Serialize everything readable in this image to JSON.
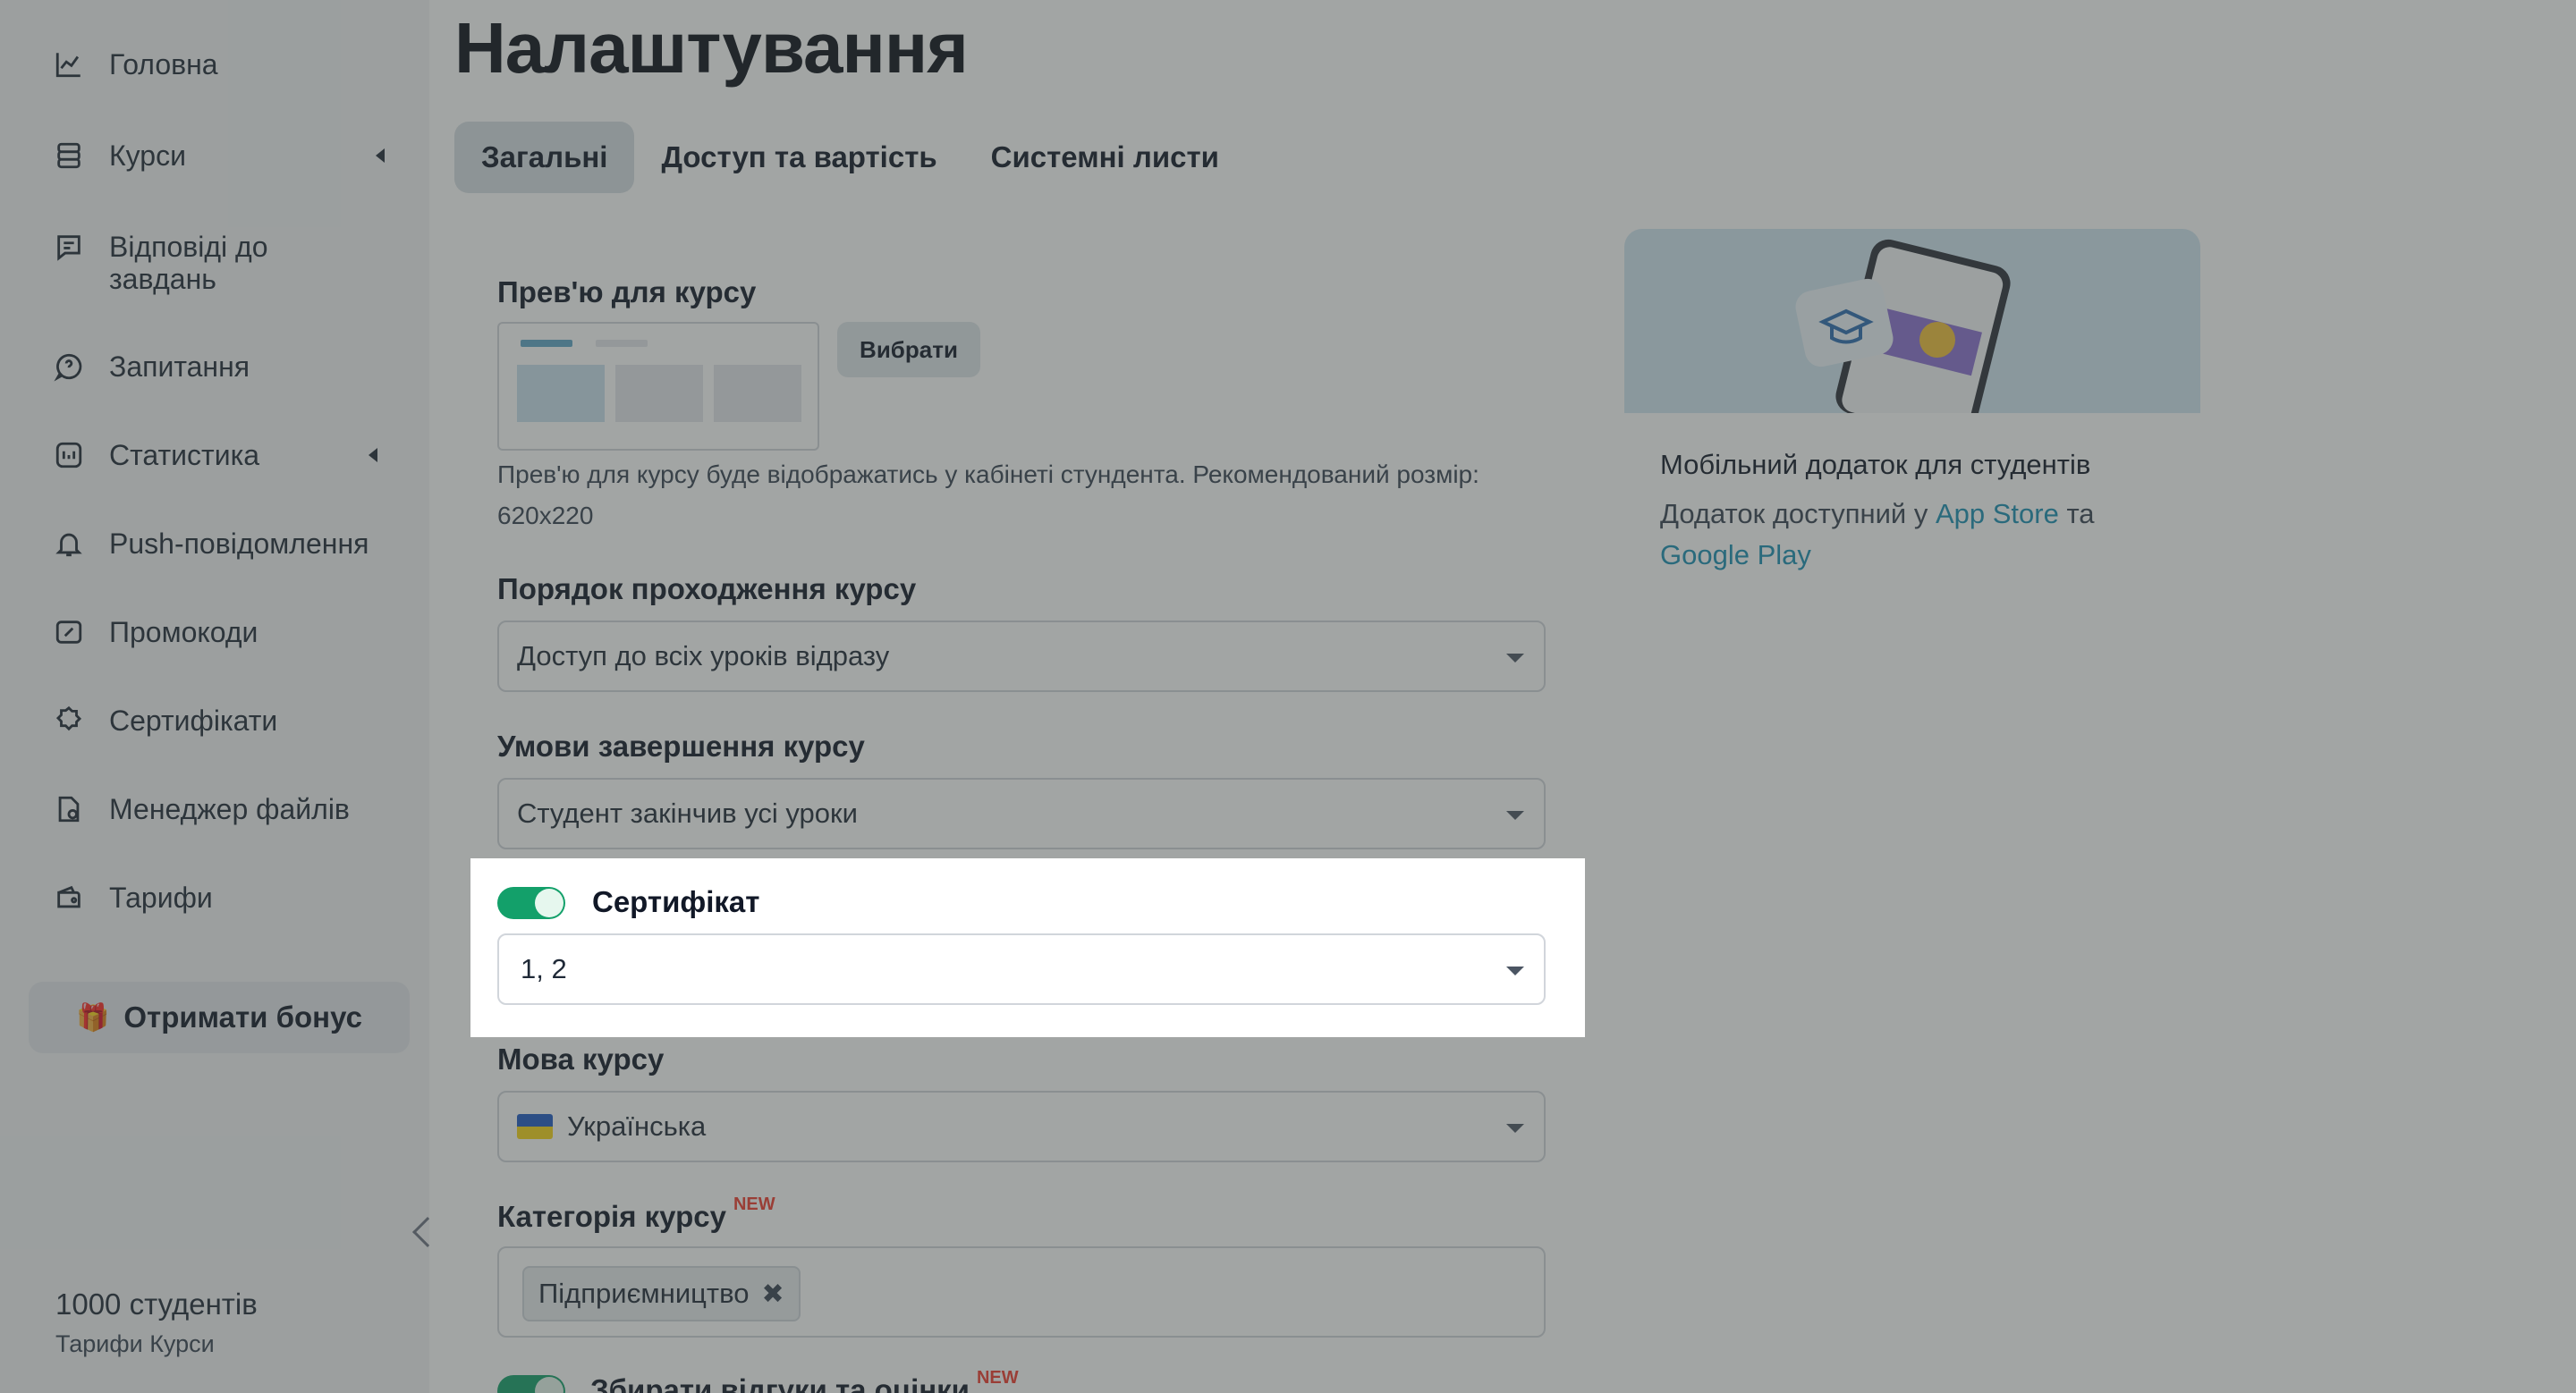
{
  "sidebar": {
    "items": [
      {
        "label": "Головна",
        "icon": "chart-line-icon"
      },
      {
        "label": "Курси",
        "icon": "stack-icon"
      },
      {
        "label": "Відповіді до\nзавдань",
        "icon": "chat-square-icon"
      },
      {
        "label": "Запитання",
        "icon": "question-icon"
      },
      {
        "label": "Статистика",
        "icon": "stats-icon"
      },
      {
        "label": "Push-повідомлення",
        "icon": "bell-icon"
      },
      {
        "label": "Промокоди",
        "icon": "coupon-icon"
      },
      {
        "label": "Сертифікати",
        "icon": "badge-icon"
      },
      {
        "label": "Менеджер файлів",
        "icon": "file-manager-icon"
      },
      {
        "label": "Тарифи",
        "icon": "wallet-icon"
      }
    ],
    "bonus_label": "Отримати бонус",
    "plan_students": "1000 студентів",
    "plan_name": "Тарифи Курси"
  },
  "page": {
    "title": "Налаштування",
    "tabs": [
      "Загальні",
      "Доступ та вартість",
      "Системні листи"
    ]
  },
  "form": {
    "preview_label": "Прев'ю для курсу",
    "choose_button": "Вибрати",
    "preview_hint": "Прев'ю для курсу буде відображатись у кабінеті стундента. Рекомендований розмір: 620x220",
    "order_label": "Порядок проходження курсу",
    "order_value": "Доступ до всіх уроків відразу",
    "completion_label": "Умови завершення курсу",
    "completion_value": "Студент закінчив усі уроки",
    "certificate_label": "Сертифікат",
    "certificate_enabled": true,
    "certificate_value": "1, 2",
    "language_label": "Мова курсу",
    "language_value": "Українська",
    "category_label": "Категорія курсу",
    "new_badge": "NEW",
    "category_tag": "Підприємництво",
    "reviews_label": "Збирати відгуки та оцінки"
  },
  "promo": {
    "title": "Мобільний додаток для студентів",
    "text_before": "Додаток доступний у ",
    "app_store": "App Store",
    "text_mid": " та",
    "google_play": "Google Play"
  },
  "colors": {
    "accent_green": "#13a06a",
    "link": "#1a8fb3",
    "new_badge": "#ef3b2d"
  }
}
